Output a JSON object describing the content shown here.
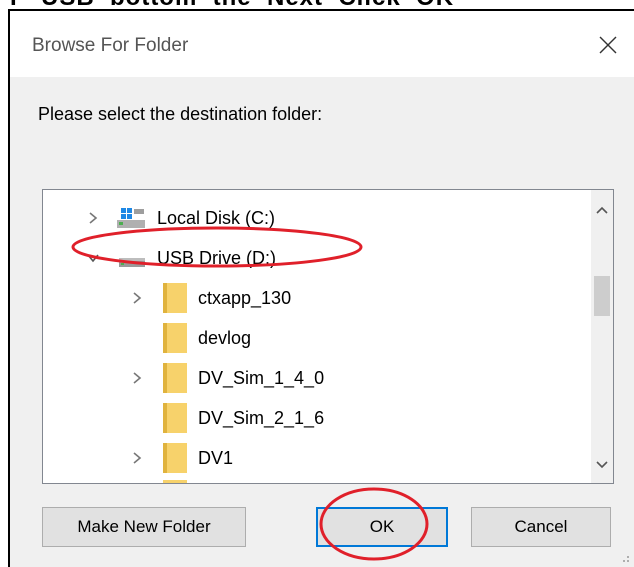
{
  "dialog": {
    "title": "Browse For Folder",
    "prompt": "Please select the destination folder:"
  },
  "tree": {
    "items": [
      {
        "label": "Local Disk (C:)",
        "icon": "drive-icon",
        "expandable": true,
        "expanded": false,
        "level": 0
      },
      {
        "label": "USB Drive (D:)",
        "icon": "usb-drive-icon",
        "expandable": true,
        "expanded": true,
        "level": 0
      },
      {
        "label": "ctxapp_130",
        "icon": "folder-icon",
        "expandable": true,
        "expanded": false,
        "level": 1
      },
      {
        "label": "devlog",
        "icon": "folder-icon",
        "expandable": false,
        "expanded": false,
        "level": 1
      },
      {
        "label": "DV_Sim_1_4_0",
        "icon": "folder-icon",
        "expandable": true,
        "expanded": false,
        "level": 1
      },
      {
        "label": "DV_Sim_2_1_6",
        "icon": "folder-icon",
        "expandable": false,
        "expanded": false,
        "level": 1
      },
      {
        "label": "DV1",
        "icon": "folder-icon",
        "expandable": true,
        "expanded": false,
        "level": 1
      }
    ]
  },
  "buttons": {
    "make_new_folder": "Make New Folder",
    "ok": "OK",
    "cancel": "Cancel"
  },
  "colors": {
    "annotation": "#e0202a",
    "folder": "#f7d26b",
    "focus_border": "#0078d7"
  }
}
